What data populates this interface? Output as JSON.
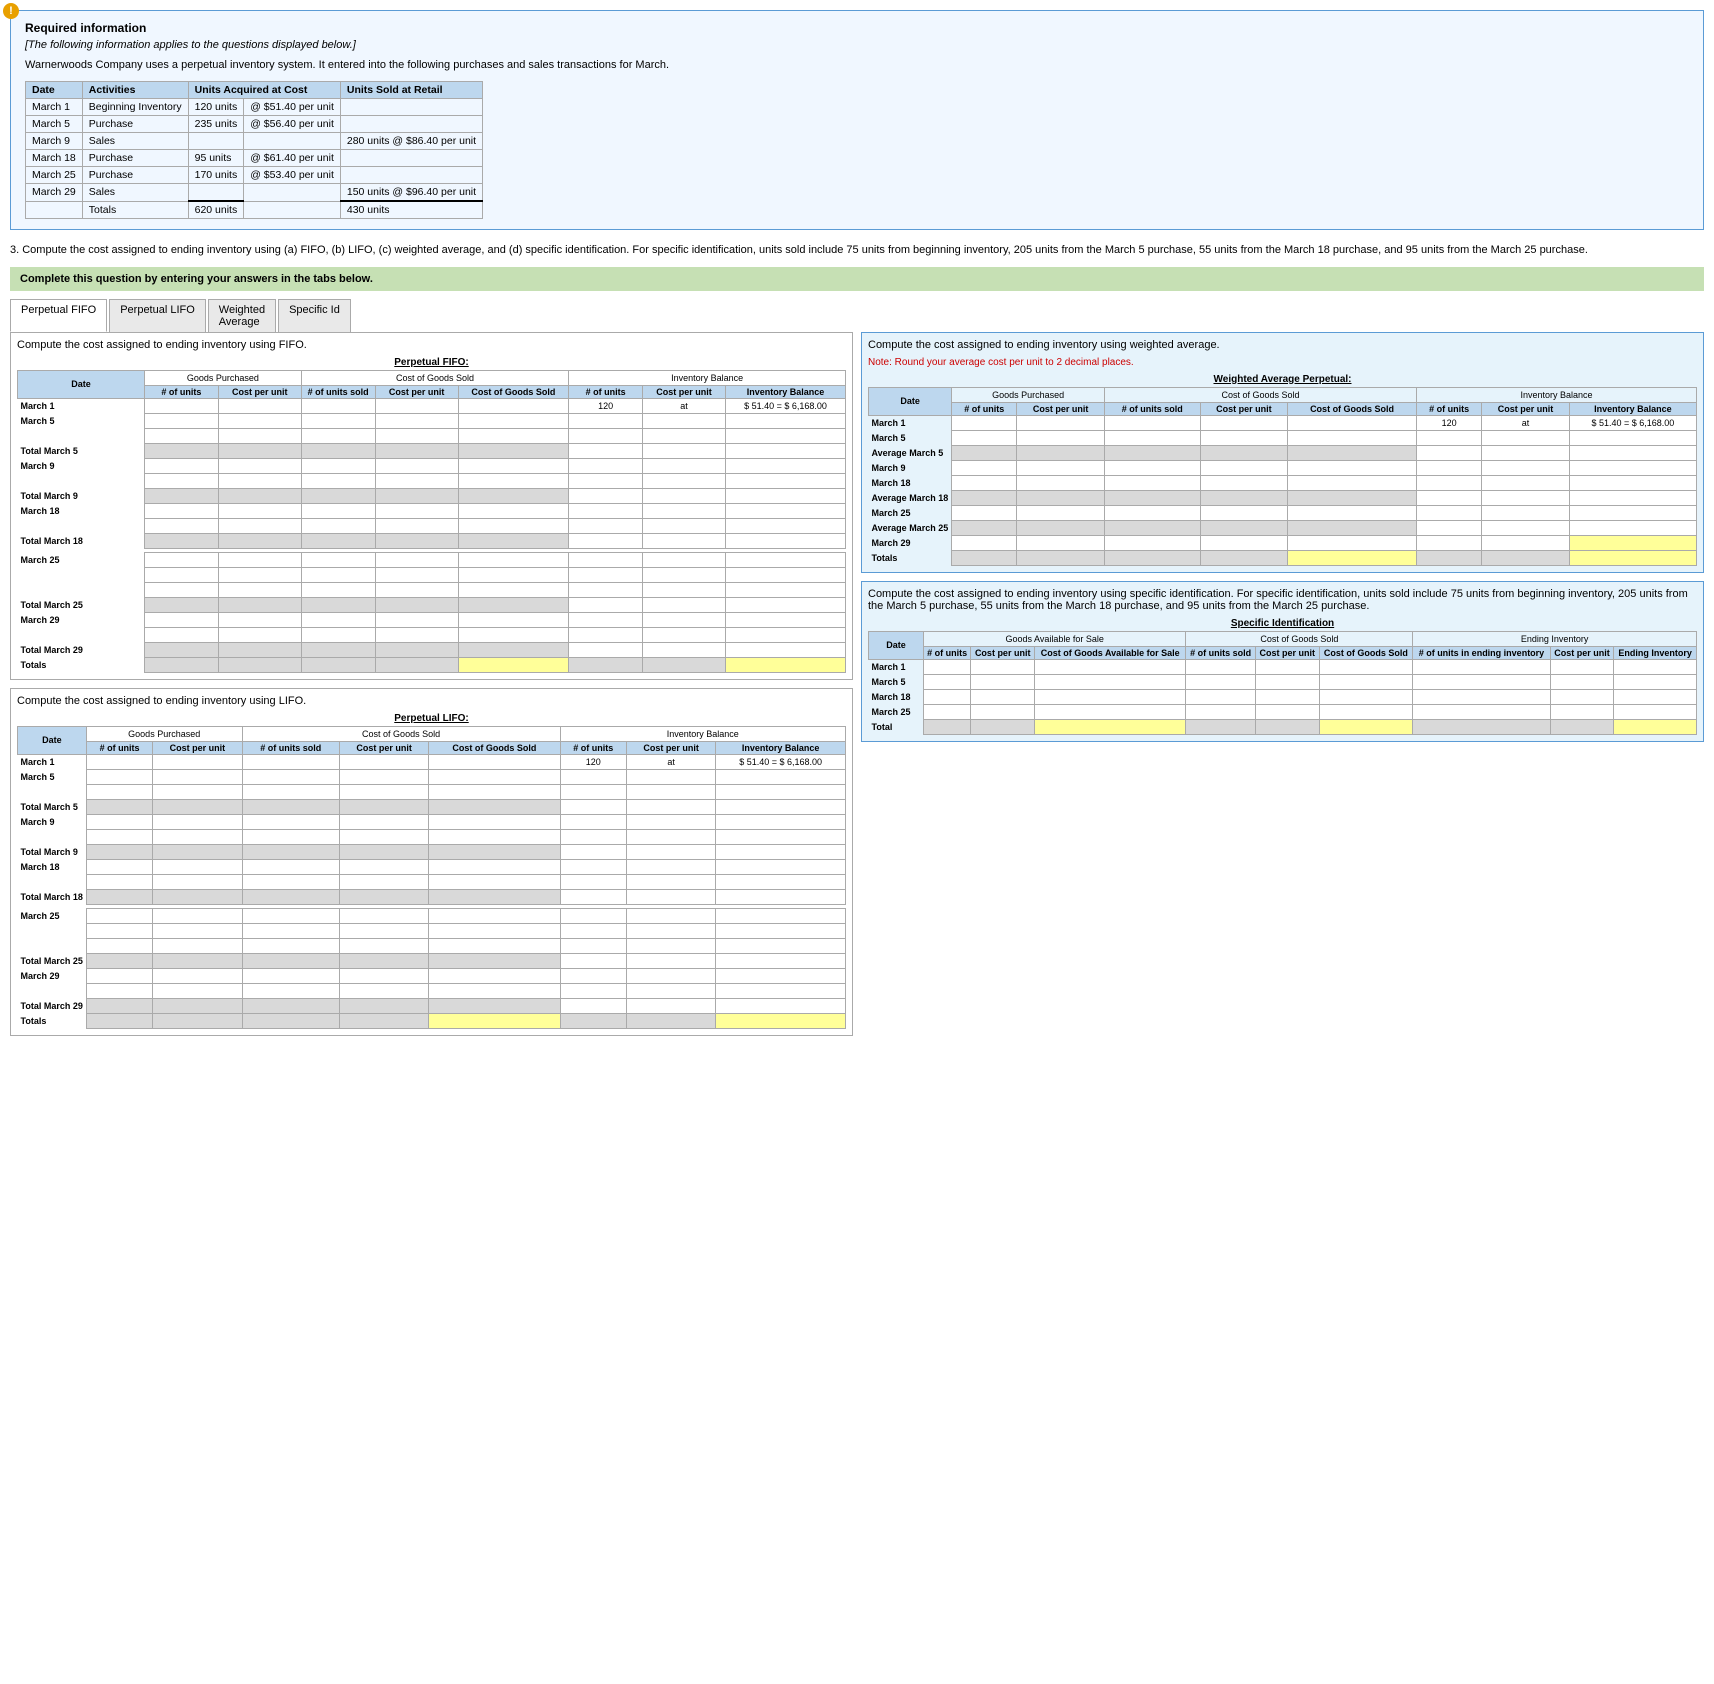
{
  "alert_icon": "!",
  "required_info": {
    "title": "Required information",
    "subtitle": "[The following information applies to the questions displayed below.]",
    "body": "Warnerwoods Company uses a perpetual inventory system. It entered into the following purchases and sales transactions for March."
  },
  "transaction_table": {
    "headers": [
      "Date",
      "Activities",
      "Units Acquired at Cost",
      "",
      "Units Sold at Retail"
    ],
    "rows": [
      [
        "March 1",
        "Beginning Inventory",
        "120 units",
        "@ $51.40 per unit",
        ""
      ],
      [
        "March 5",
        "Purchase",
        "235 units",
        "@ $56.40 per unit",
        ""
      ],
      [
        "March 9",
        "Sales",
        "",
        "",
        "280 units  @ $86.40 per unit"
      ],
      [
        "March 18",
        "Purchase",
        "95 units",
        "@ $61.40 per unit",
        ""
      ],
      [
        "March 25",
        "Purchase",
        "170 units",
        "@ $53.40 per unit",
        ""
      ],
      [
        "March 29",
        "Sales",
        "",
        "",
        "150 units  @ $96.40 per unit"
      ],
      [
        "",
        "Totals",
        "620 units",
        "",
        "430 units"
      ]
    ]
  },
  "question3": {
    "text": "3. Compute the cost assigned to ending inventory using (a) FIFO, (b) LIFO, (c) weighted average, and (d) specific identification. For specific identification, units sold include 75 units from beginning inventory, 205 units from the March 5 purchase, 55 units from the March 18 purchase, and 95 units from the March 25 purchase."
  },
  "complete_box": "Complete this question by entering your answers in the tabs below.",
  "tabs": [
    "Perpetual FIFO",
    "Perpetual LIFO",
    "Weighted Average",
    "Specific Id"
  ],
  "active_tab": "Perpetual FIFO",
  "fifo_section": {
    "title": "Compute the cost assigned to ending inventory using FIFO.",
    "table_title": "Perpetual FIFO:",
    "col_groups": [
      "Goods Purchased",
      "Cost of Goods Sold",
      "Inventory Balance"
    ],
    "sub_headers_purchased": [
      "# of units",
      "Cost per unit"
    ],
    "sub_headers_cogs": [
      "# of units sold",
      "Cost per unit",
      "Cost of Goods Sold"
    ],
    "sub_headers_inventory": [
      "# of units",
      "Cost per unit",
      "Inventory Balance"
    ],
    "rows": [
      {
        "label": "March 1",
        "special": "120 at $ 51.40 = $ 6,168.00"
      },
      {
        "label": "March 5"
      },
      {
        "label": "Total March 5"
      },
      {
        "label": "March 9"
      },
      {
        "label": "Total March 9"
      },
      {
        "label": "March 18"
      },
      {
        "label": "Total March 18"
      },
      {
        "label": "March 25"
      },
      {
        "label": "Total March 25"
      },
      {
        "label": "March 29"
      },
      {
        "label": "Total March 29"
      },
      {
        "label": "Totals"
      }
    ]
  },
  "lifo_section": {
    "title": "Compute the cost assigned to ending inventory using LIFO.",
    "table_title": "Perpetual LIFO:",
    "rows": [
      {
        "label": "March 1",
        "special": "120 at $ 51.40 = $ 6,168.00"
      },
      {
        "label": "March 5"
      },
      {
        "label": "Total March 5"
      },
      {
        "label": "March 9"
      },
      {
        "label": "Total March 9"
      },
      {
        "label": "March 18"
      },
      {
        "label": "Total March 18"
      },
      {
        "label": "March 25"
      },
      {
        "label": "Total March 25"
      },
      {
        "label": "March 29"
      },
      {
        "label": "Total March 29"
      },
      {
        "label": "Totals"
      }
    ]
  },
  "weighted_avg_section": {
    "title": "Compute the cost assigned to ending inventory using weighted average.",
    "note": "Note: Round your average cost per unit to 2 decimal places.",
    "table_title": "Weighted Average Perpetual:",
    "rows": [
      {
        "label": "March 1",
        "special": "120 at $ 51.40 = $ 6,168.00"
      },
      {
        "label": "March 5"
      },
      {
        "label": "Average March 5"
      },
      {
        "label": "March 9"
      },
      {
        "label": "March 18"
      },
      {
        "label": "Average March 18"
      },
      {
        "label": "March 25"
      },
      {
        "label": "Average March 25"
      },
      {
        "label": "March 29"
      },
      {
        "label": "Totals"
      }
    ]
  },
  "specific_id_section": {
    "title": "Compute the cost assigned to ending inventory using specific identification. For specific identification, units sold include 75 units from beginning inventory, 205 units from the March 5 purchase, 55 units from the March 18 purchase, and 95 units from the March 25 purchase.",
    "table_title": "Specific Identification",
    "col_groups": [
      "Goods Available for Sale",
      "Cost of Goods Sold",
      "Ending Inventory"
    ],
    "sub_headers_available": [
      "# of units",
      "Cost per unit",
      "Cost of Goods Available for Sale"
    ],
    "sub_headers_cogs": [
      "# of units sold",
      "Cost per unit",
      "Cost of Goods Sold"
    ],
    "sub_headers_ending": [
      "# of units in ending inventory",
      "Cost per unit",
      "Ending Inventory"
    ],
    "rows": [
      {
        "label": "March 1"
      },
      {
        "label": "March 5"
      },
      {
        "label": "March 18"
      },
      {
        "label": "March 25"
      },
      {
        "label": "Total"
      }
    ]
  }
}
